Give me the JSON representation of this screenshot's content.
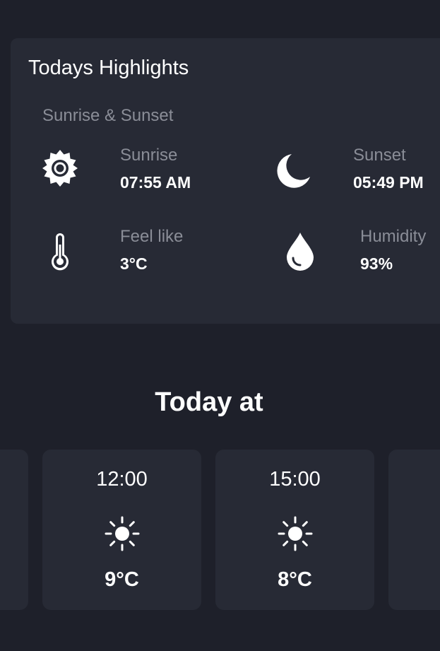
{
  "highlights": {
    "title": "Todays Highlights",
    "section_label": "Sunrise & Sunset",
    "sunrise": {
      "label": "Sunrise",
      "value": "07:55 AM",
      "icon": "sun-icon"
    },
    "sunset": {
      "label": "Sunset",
      "value": "05:49 PM",
      "icon": "moon-icon"
    },
    "feel_like": {
      "label": "Feel like",
      "value": "3°C",
      "icon": "thermometer-icon"
    },
    "humidity": {
      "label": "Humidity",
      "value": "93%",
      "icon": "droplet-icon"
    }
  },
  "today": {
    "title": "Today at",
    "forecast": [
      {
        "time": "12:00",
        "temp": "9°C",
        "icon": "sun-icon"
      },
      {
        "time": "15:00",
        "temp": "8°C",
        "icon": "sun-icon"
      }
    ]
  },
  "colors": {
    "background": "#1e202a",
    "card": "#272a35",
    "muted_text": "#8a8d97",
    "text": "#ffffff"
  }
}
